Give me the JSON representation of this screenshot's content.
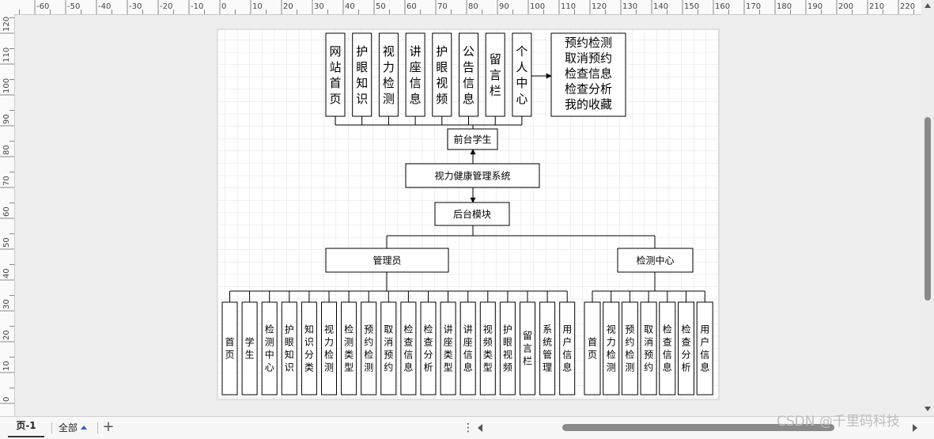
{
  "ruler": {
    "h_ticks": [
      "-60",
      "-50",
      "-40",
      "-30",
      "-20",
      "-10",
      "0",
      "10",
      "20",
      "30",
      "40",
      "50",
      "60",
      "70",
      "80",
      "90",
      "100",
      "110",
      "120",
      "130",
      "140",
      "150",
      "160",
      "170",
      "180",
      "190",
      "200",
      "210",
      "220"
    ],
    "v_ticks": [
      "120",
      "110",
      "100",
      "90",
      "80",
      "70",
      "60",
      "50",
      "40",
      "30",
      "20",
      "10",
      "0"
    ]
  },
  "diagram": {
    "top_items": [
      "网站首页",
      "护眼知识",
      "视力检测",
      "讲座信息",
      "护眼视频",
      "公告信息",
      "留言栏",
      "个人中心"
    ],
    "personal_center_items": [
      "预约检测",
      "取消预约",
      "检查信息",
      "检查分析",
      "我的收藏"
    ],
    "front_node": "前台学生",
    "system_node": "视力健康管理系统",
    "backend_node": "后台模块",
    "admin_node": "管理员",
    "center_node": "检测中心",
    "admin_items": [
      "首页",
      "学生",
      "检测中心",
      "护眼知识",
      "知识分类",
      "视力检测",
      "检测类型",
      "预约检测",
      "取消预约",
      "检查信息",
      "检查分析",
      "讲座类型",
      "讲座信息",
      "视频类型",
      "护眼视频",
      "留言栏",
      "系统管理",
      "用户信息"
    ],
    "center_items": [
      "首页",
      "视力检测",
      "预约检测",
      "取消预约",
      "检查信息",
      "检查分析",
      "用户信息"
    ]
  },
  "bottom_bar": {
    "page_tab": "页-1",
    "all_label": "全部",
    "add_symbol": "+",
    "more_symbol": "⋮"
  },
  "watermark": "CSDN @千里码科技"
}
